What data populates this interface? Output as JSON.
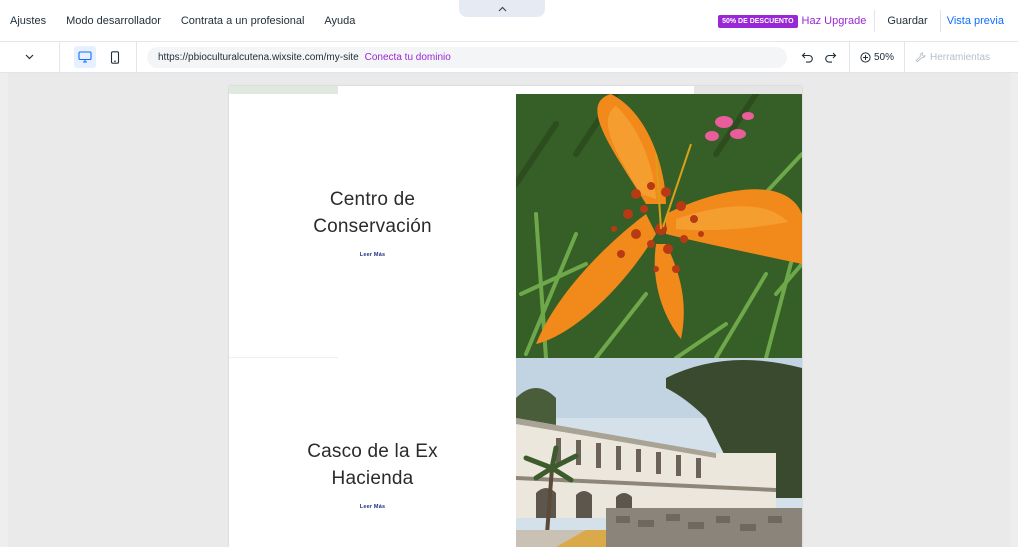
{
  "menu": {
    "items": [
      "Ajustes",
      "Modo desarrollador",
      "Contrata a un profesional",
      "Ayuda"
    ],
    "collapse_icon": "chevron-up-icon"
  },
  "topbar": {
    "discount_badge": "50% DE DESCUENTO",
    "upgrade_label": "Haz Upgrade",
    "save_label": "Guardar",
    "preview_label": "Vista previa"
  },
  "toolbar": {
    "page_dropdown_icon": "chevron-down-icon",
    "device_desktop_icon": "desktop-icon",
    "device_mobile_icon": "mobile-icon",
    "url": "https://pbioculturalcutena.wixsite.com/my-site",
    "connect_domain_label": "Conecta tu dominio",
    "zoom_label": "50%",
    "tools_label": "Herramientas"
  },
  "site": {
    "sections": [
      {
        "title_line1": "Centro de",
        "title_line2": "Conservación",
        "link": "Leer Más"
      },
      {
        "title_line1": "Casco de la Ex",
        "title_line2": "Hacienda",
        "link": "Leer Más"
      }
    ]
  },
  "colors": {
    "accent_purple": "#9a27d5",
    "accent_blue": "#116dff",
    "link_navy": "#1f2f88",
    "canvas_bg": "#eeeeee"
  }
}
